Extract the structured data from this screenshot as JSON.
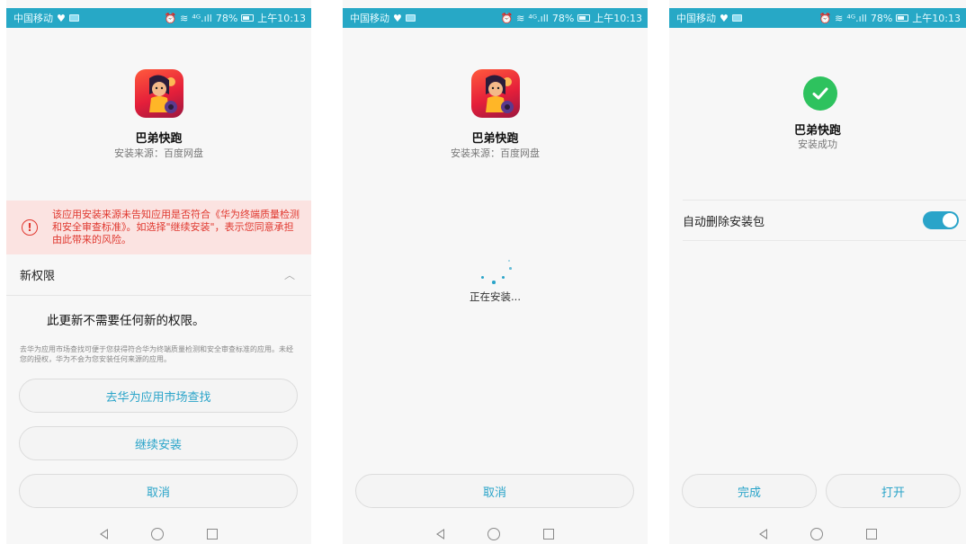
{
  "status_bar": {
    "carrier": "中国移动",
    "signal_text": "⁴ᴳ.ıll",
    "battery": "78%",
    "time": "上午10:13"
  },
  "app": {
    "name": "巴弟快跑",
    "source": "安装来源：百度网盘",
    "icon": "game-character-icon"
  },
  "screen1": {
    "warning": "该应用安装来源未告知应用是否符合《华为终端质量检测和安全审查标准》。如选择\"继续安装\"，表示您同意承担由此带来的风险。",
    "section_title": "新权限",
    "no_permissions": "此更新不需要任何新的权限。",
    "hint": "去华为应用市场查找可便于您获得符合华为终端质量检测和安全审查标准的应用。未经您的授权，华为不会为您安装任何来源的应用。",
    "buttons": {
      "market": "去华为应用市场查找",
      "continue": "继续安装",
      "cancel": "取消"
    }
  },
  "screen2": {
    "installing": "正在安装...",
    "cancel": "取消"
  },
  "screen3": {
    "result": "安装成功",
    "auto_delete_label": "自动删除安装包",
    "auto_delete_on": true,
    "done": "完成",
    "open": "打开"
  },
  "colors": {
    "status_bar": "#27a8c6",
    "accent": "#2aa4c9",
    "warning_bg": "#fbe3e1",
    "warning_text": "#e0382f",
    "success": "#2ec25e"
  }
}
